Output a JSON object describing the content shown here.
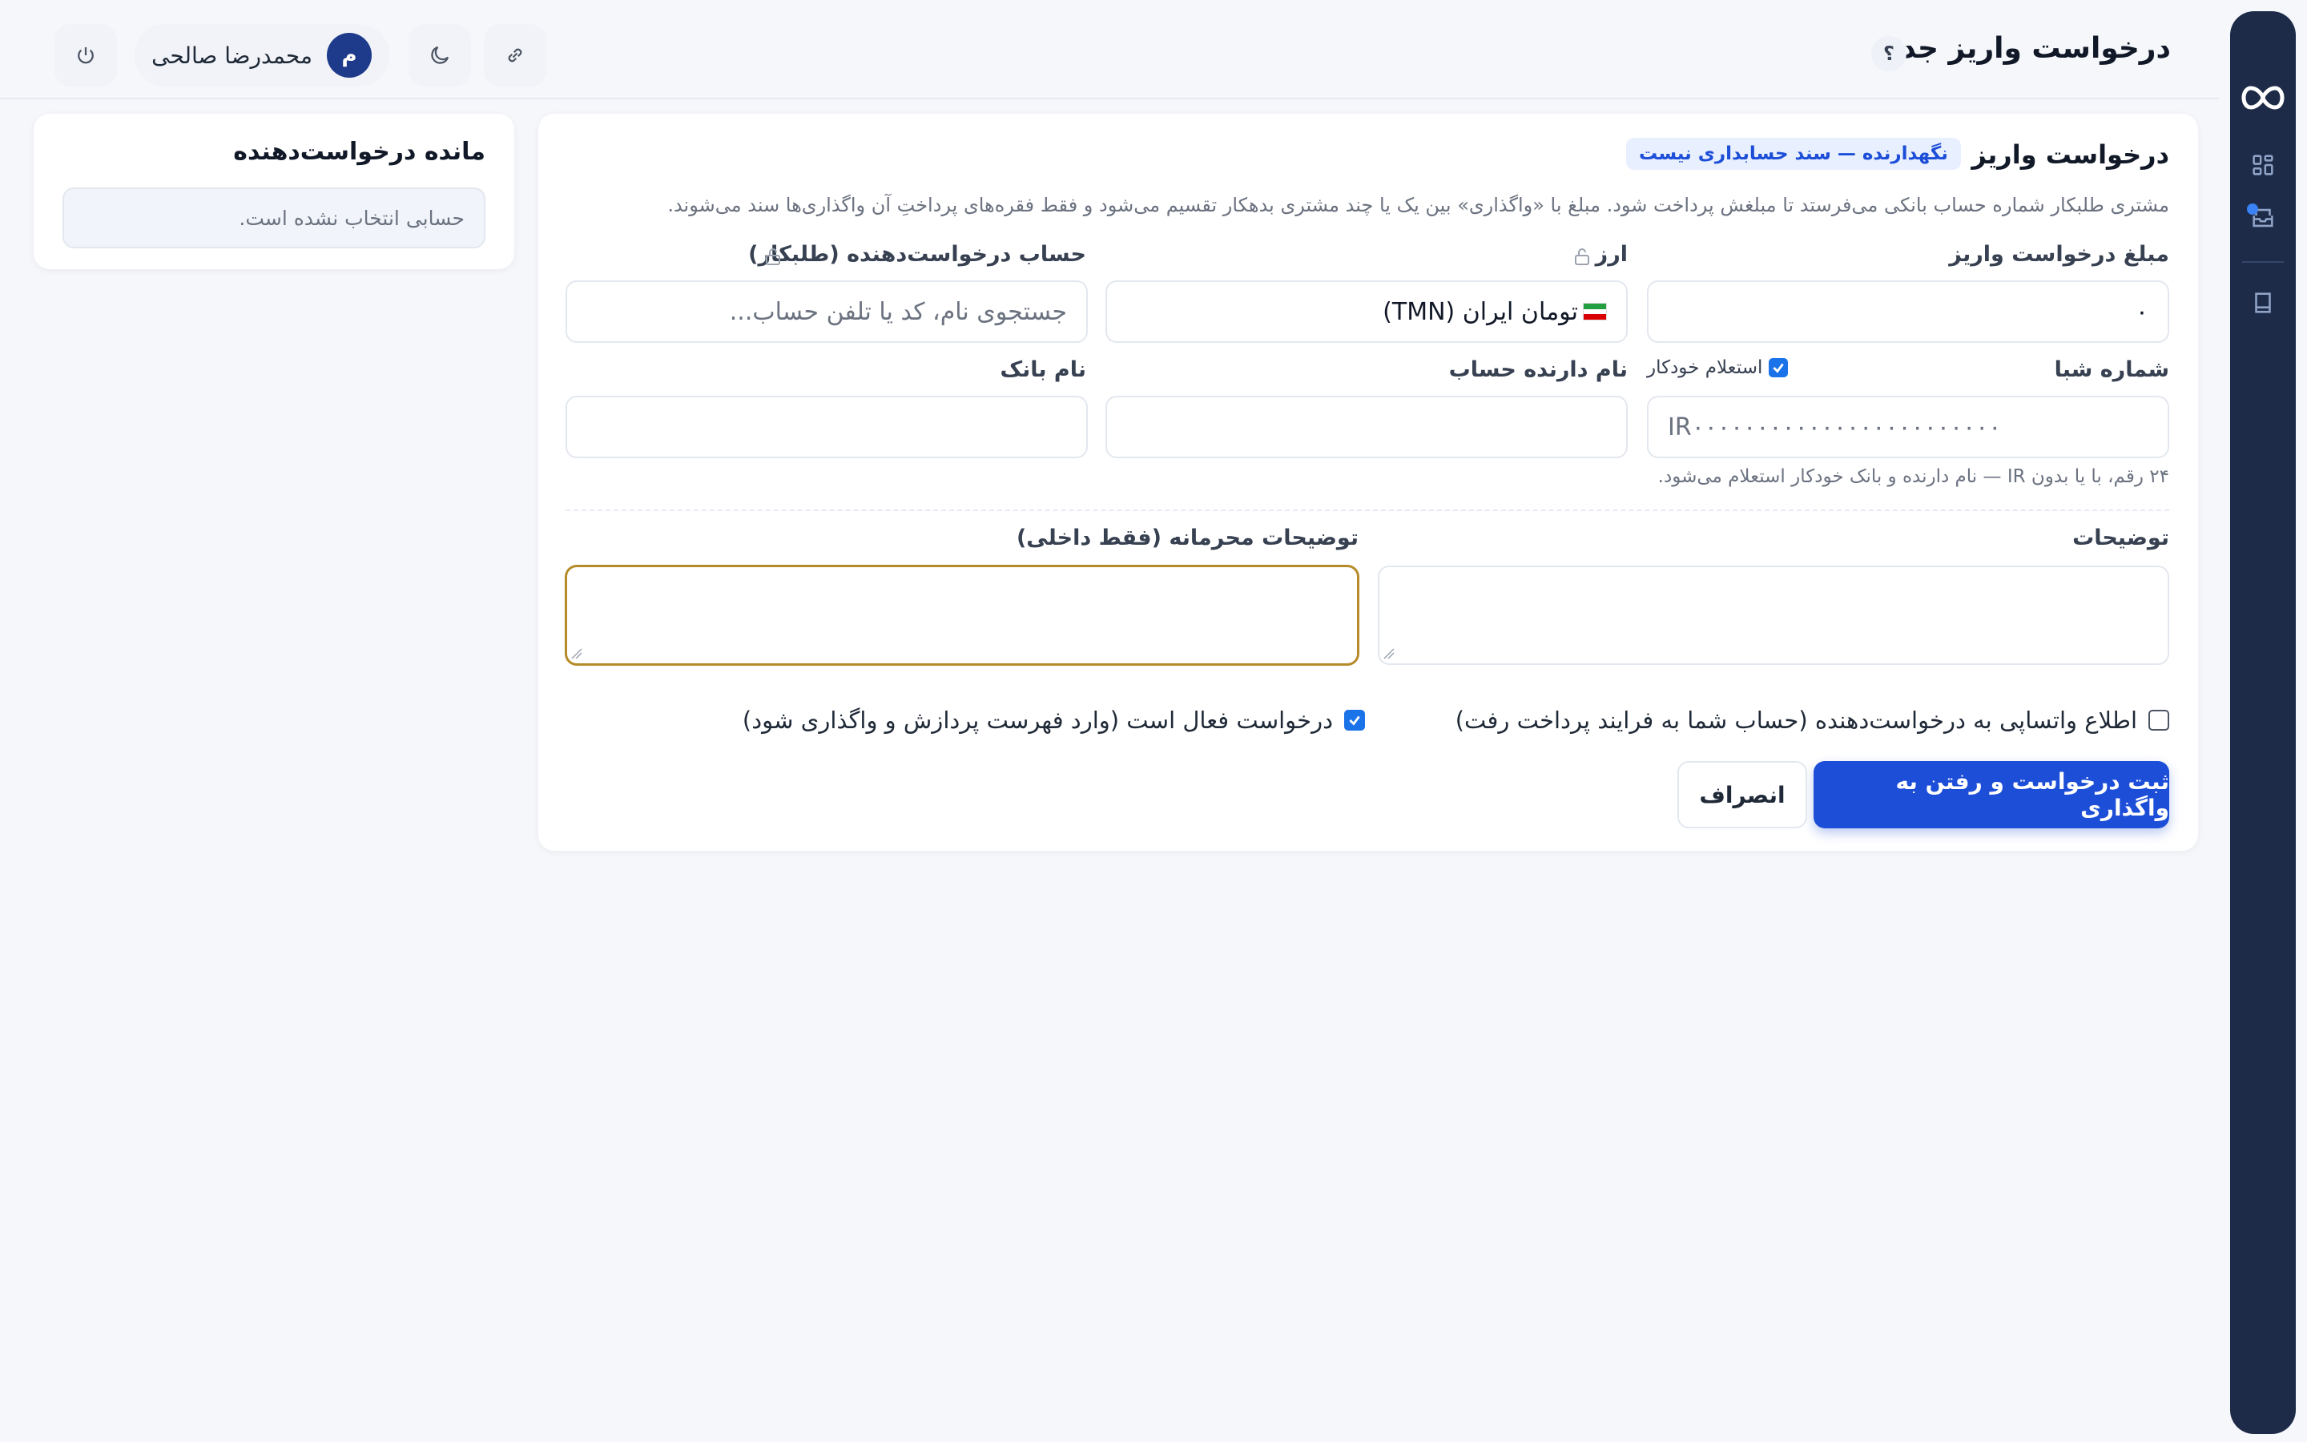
{
  "header": {
    "title": "درخواست واریز جدید",
    "help_label": "؟",
    "user": {
      "name": "محمدرضا صالحی",
      "initial": "م"
    },
    "icons": [
      "help-icon",
      "link-icon",
      "moon-icon",
      "power-icon"
    ]
  },
  "sidebar": {
    "logo": "infinity-logo-icon",
    "items": [
      "grid-icon",
      "inbox-icon",
      "book-icon"
    ],
    "accent": "#3b82f6"
  },
  "form": {
    "title": "درخواست واریز جدید",
    "tag": "نگهدارنده — سند حسابداری نیست",
    "intro": "مشتری طلبکار شماره حساب بانکی می‌فرستد تا مبلغش پرداخت شود. مبلغ با «واگذاری» بین یک یا چند مشتری بدهکار تقسیم می‌شود و فقط فقره‌های پرداختِ آن واگذاری‌ها سند می‌شوند.",
    "amount": {
      "label": "مبلغ درخواست واریز",
      "value": "۰"
    },
    "currency": {
      "label": "ارز",
      "value": "تومان ایران (TMN)"
    },
    "requester": {
      "label": "حساب درخواست‌دهنده (طلبکار)",
      "placeholder": "جستجوی نام، کد یا تلفن حساب..."
    },
    "sheba": {
      "label": "شماره شبا",
      "auto_inquiry_label": "استعلام خودکار",
      "auto_inquiry_checked": true,
      "value": "IR۰۰۰۰۰۰۰۰۰۰۰۰۰۰۰۰۰۰۰۰۰۰۰۰",
      "hint": "۲۴ رقم، با یا بدون IR — نام دارنده و بانک خودکار استعلام می‌شود."
    },
    "holder_name": {
      "label": "نام دارنده حساب",
      "value": ""
    },
    "bank_name": {
      "label": "نام بانک",
      "value": ""
    },
    "notes": {
      "label": "توضیحات",
      "value": ""
    },
    "private_notes": {
      "label": "توضیحات محرمانه (فقط داخلی)",
      "value": ""
    },
    "whatsapp": {
      "label": "اطلاع واتساپی به درخواست‌دهنده (حساب شما به فرایند پرداخت رفت)",
      "checked": false
    },
    "active": {
      "label": "درخواست فعال است (وارد فهرست پردازش و واگذاری شود)",
      "checked": true
    },
    "submit_label": "ثبت درخواست و رفتن به واگذاری",
    "cancel_label": "انصراف"
  },
  "balance": {
    "title": "مانده درخواست‌دهنده",
    "empty": "حسابی انتخاب نشده است."
  }
}
